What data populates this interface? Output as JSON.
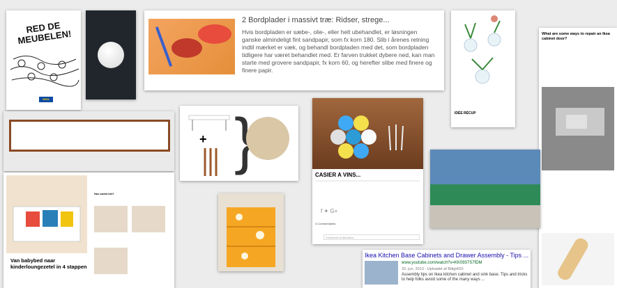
{
  "card_red": {
    "title": "RED DE MEUBELEN!",
    "brand": "IKEA"
  },
  "card_bordplader": {
    "heading": "2  Bordplader i massivt træ: Ridser, strege...",
    "body": "Hvis bordpladen er sæbe-, olie-, eller helt ubehandlet, er løsningen ganske almindeligt fint sandpapir, som fx korn 180. Slib i årenes retning indtil mærket er væk, og behandl bordpladen med det, som bordpladen tidligere har været behandlet med. Er farven trukket dybere ned, kan man starte med grovere sandpapir, fx korn 60, og herefter slibe med finere og finere papir."
  },
  "card_vases": {
    "caption": "IDÉE RÉCUP"
  },
  "card_repair": {
    "question": "What are some ways to repair an Ikea cabinet door?"
  },
  "card_casier": {
    "title": "CASIER A VINS...",
    "share_label": "Partager",
    "comments_label": "4 Commentaires",
    "comment_placeholder": "Commencer la discussion..."
  },
  "card_baby": {
    "title": "Van babybed naar kinderloungezetel in 4 stappen",
    "steps_label": "Hoe werkt het?"
  },
  "card_youtube": {
    "title": "Ikea Kitchen Base Cabinets and Drawer Assembly - Tips ...",
    "url": "www.youtube.com/watch?v=KK0937S7fDM",
    "meta": "20. jun. 2013 - Uploadet af BdigHDX",
    "description": "Assembly tips on Ikea kitchen cabinet and sink base. Tips and tricks to help folks avoid some of the many ways ..."
  }
}
